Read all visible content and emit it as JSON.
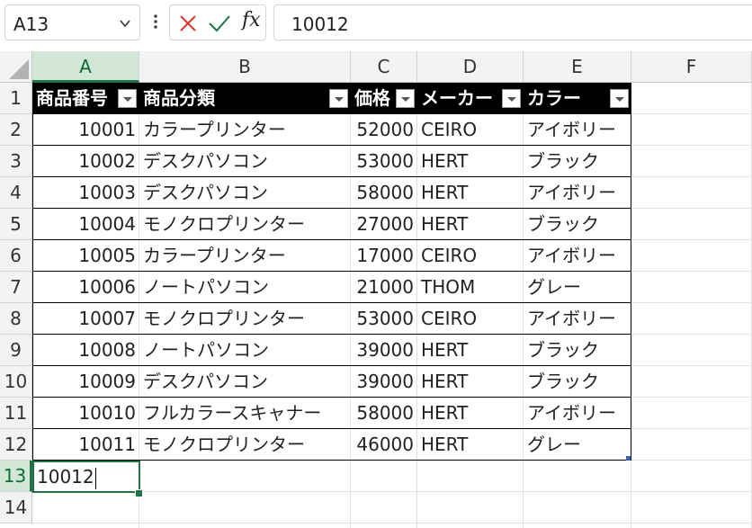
{
  "name_box": {
    "value": "A13"
  },
  "formula_bar": {
    "value": "10012"
  },
  "columns": [
    "A",
    "B",
    "C",
    "D",
    "E",
    "F"
  ],
  "rows": [
    "1",
    "2",
    "3",
    "4",
    "5",
    "6",
    "7",
    "8",
    "9",
    "10",
    "11",
    "12",
    "13",
    "14"
  ],
  "selected_column": "A",
  "selected_row": "13",
  "table": {
    "headers": [
      "商品番号",
      "商品分類",
      "価格",
      "メーカー",
      "カラー"
    ],
    "data": [
      [
        "10001",
        "カラープリンター",
        "52000",
        "CEIRO",
        "アイボリー"
      ],
      [
        "10002",
        "デスクパソコン",
        "53000",
        "HERT",
        "ブラック"
      ],
      [
        "10003",
        "デスクパソコン",
        "58000",
        "HERT",
        "アイボリー"
      ],
      [
        "10004",
        "モノクロプリンター",
        "27000",
        "HERT",
        "ブラック"
      ],
      [
        "10005",
        "カラープリンター",
        "17000",
        "CEIRO",
        "アイボリー"
      ],
      [
        "10006",
        "ノートパソコン",
        "21000",
        "THOM",
        "グレー"
      ],
      [
        "10007",
        "モノクロプリンター",
        "53000",
        "CEIRO",
        "アイボリー"
      ],
      [
        "10008",
        "ノートパソコン",
        "39000",
        "HERT",
        "ブラック"
      ],
      [
        "10009",
        "デスクパソコン",
        "39000",
        "HERT",
        "ブラック"
      ],
      [
        "10010",
        "フルカラースキャナー",
        "58000",
        "HERT",
        "アイボリー"
      ],
      [
        "10011",
        "モノクロプリンター",
        "46000",
        "HERT",
        "グレー"
      ]
    ]
  },
  "active_cell": {
    "ref": "A13",
    "editing_value": "10012"
  },
  "icons": {
    "name_box_dropdown": "chevron-down-icon",
    "more": "vertical-dots-icon",
    "cancel": "x-icon",
    "enter": "check-icon",
    "function": "fx-icon",
    "filter": "filter-dropdown-icon"
  },
  "fx_label": "fx",
  "colors": {
    "accent": "#217346",
    "cancel": "#d9342b",
    "header_fill": "#000000",
    "header_text": "#ffffff"
  }
}
